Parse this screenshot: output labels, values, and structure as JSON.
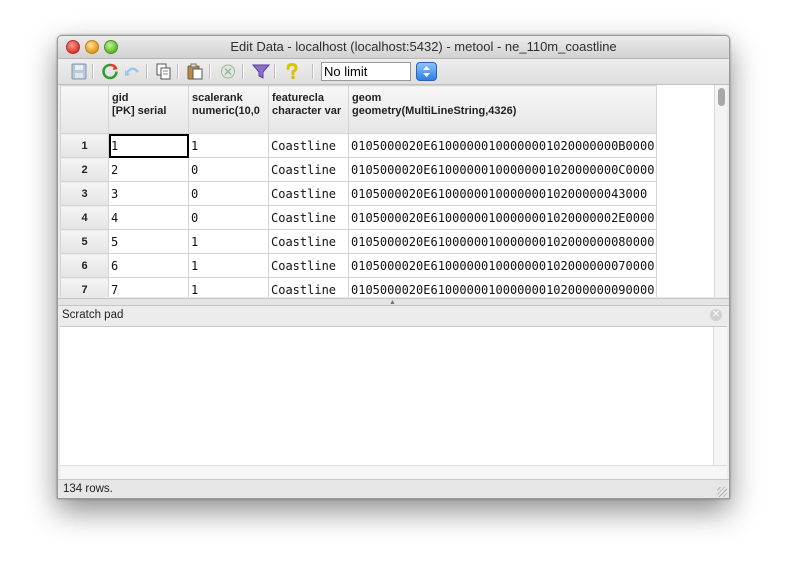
{
  "window": {
    "title": "Edit Data - localhost (localhost:5432) - metool - ne_110m_coastline"
  },
  "toolbar": {
    "limit_value": "No limit",
    "icons": [
      "save-icon",
      "refresh-icon",
      "undo-icon",
      "copy-icon",
      "paste-icon",
      "delete-icon",
      "filter-icon",
      "help-icon"
    ]
  },
  "grid": {
    "columns": [
      {
        "name": "gid",
        "type": "[PK] serial"
      },
      {
        "name": "scalerank",
        "type": "numeric(10,0"
      },
      {
        "name": "featurecla",
        "type": "character var"
      },
      {
        "name": "geom",
        "type": "geometry(MultiLineString,4326)"
      }
    ],
    "rows": [
      {
        "num": "1",
        "cells": [
          "1",
          "1",
          "Coastline",
          "0105000020E61000000100000001020000000B0000"
        ]
      },
      {
        "num": "2",
        "cells": [
          "2",
          "0",
          "Coastline",
          "0105000020E61000000100000001020000000C0000"
        ]
      },
      {
        "num": "3",
        "cells": [
          "3",
          "0",
          "Coastline",
          "0105000020E610000001000000010200000043000"
        ]
      },
      {
        "num": "4",
        "cells": [
          "4",
          "0",
          "Coastline",
          "0105000020E61000000100000001020000002E0000"
        ]
      },
      {
        "num": "5",
        "cells": [
          "5",
          "1",
          "Coastline",
          "0105000020E6100000010000000102000000080000"
        ]
      },
      {
        "num": "6",
        "cells": [
          "6",
          "1",
          "Coastline",
          "0105000020E6100000010000000102000000070000"
        ]
      },
      {
        "num": "7",
        "cells": [
          "7",
          "1",
          "Coastline",
          "0105000020E6100000010000000102000000090000"
        ]
      }
    ]
  },
  "scratch_pad": {
    "label": "Scratch pad"
  },
  "status": {
    "text": "134 rows."
  }
}
